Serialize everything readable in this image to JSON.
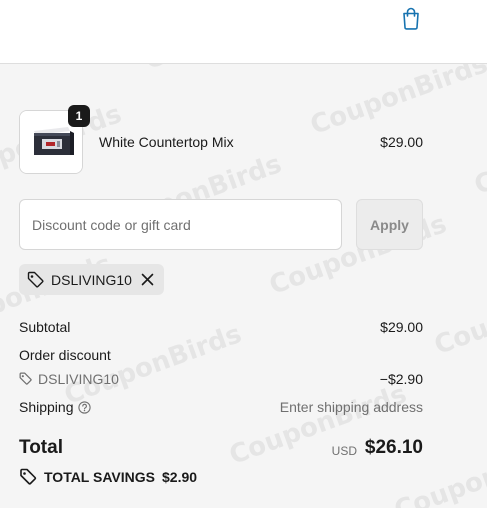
{
  "header": {
    "cart_icon": "shopping-bag-icon"
  },
  "line_item": {
    "quantity": "1",
    "name": "White Countertop Mix",
    "price": "$29.00",
    "thumbnail": "product-box-image"
  },
  "discount": {
    "placeholder": "Discount code or gift card",
    "value": "",
    "apply_label": "Apply"
  },
  "applied_code": {
    "icon": "tag-icon",
    "code": "DSLIVING10",
    "remove_icon": "close-icon"
  },
  "summary": {
    "subtotal_label": "Subtotal",
    "subtotal_value": "$29.00",
    "order_discount_label": "Order discount",
    "discount_code": "DSLIVING10",
    "discount_value": "−$2.90",
    "shipping_label": "Shipping",
    "shipping_value": "Enter shipping address",
    "total_label": "Total",
    "currency": "USD",
    "total_value": "$26.10",
    "savings_label": "TOTAL SAVINGS",
    "savings_value": "$2.90"
  },
  "watermark": "CouponBirds",
  "colors": {
    "accent": "#1773b0",
    "background": "#f5f5f5",
    "text": "#1a1a1a",
    "muted": "#707070"
  }
}
